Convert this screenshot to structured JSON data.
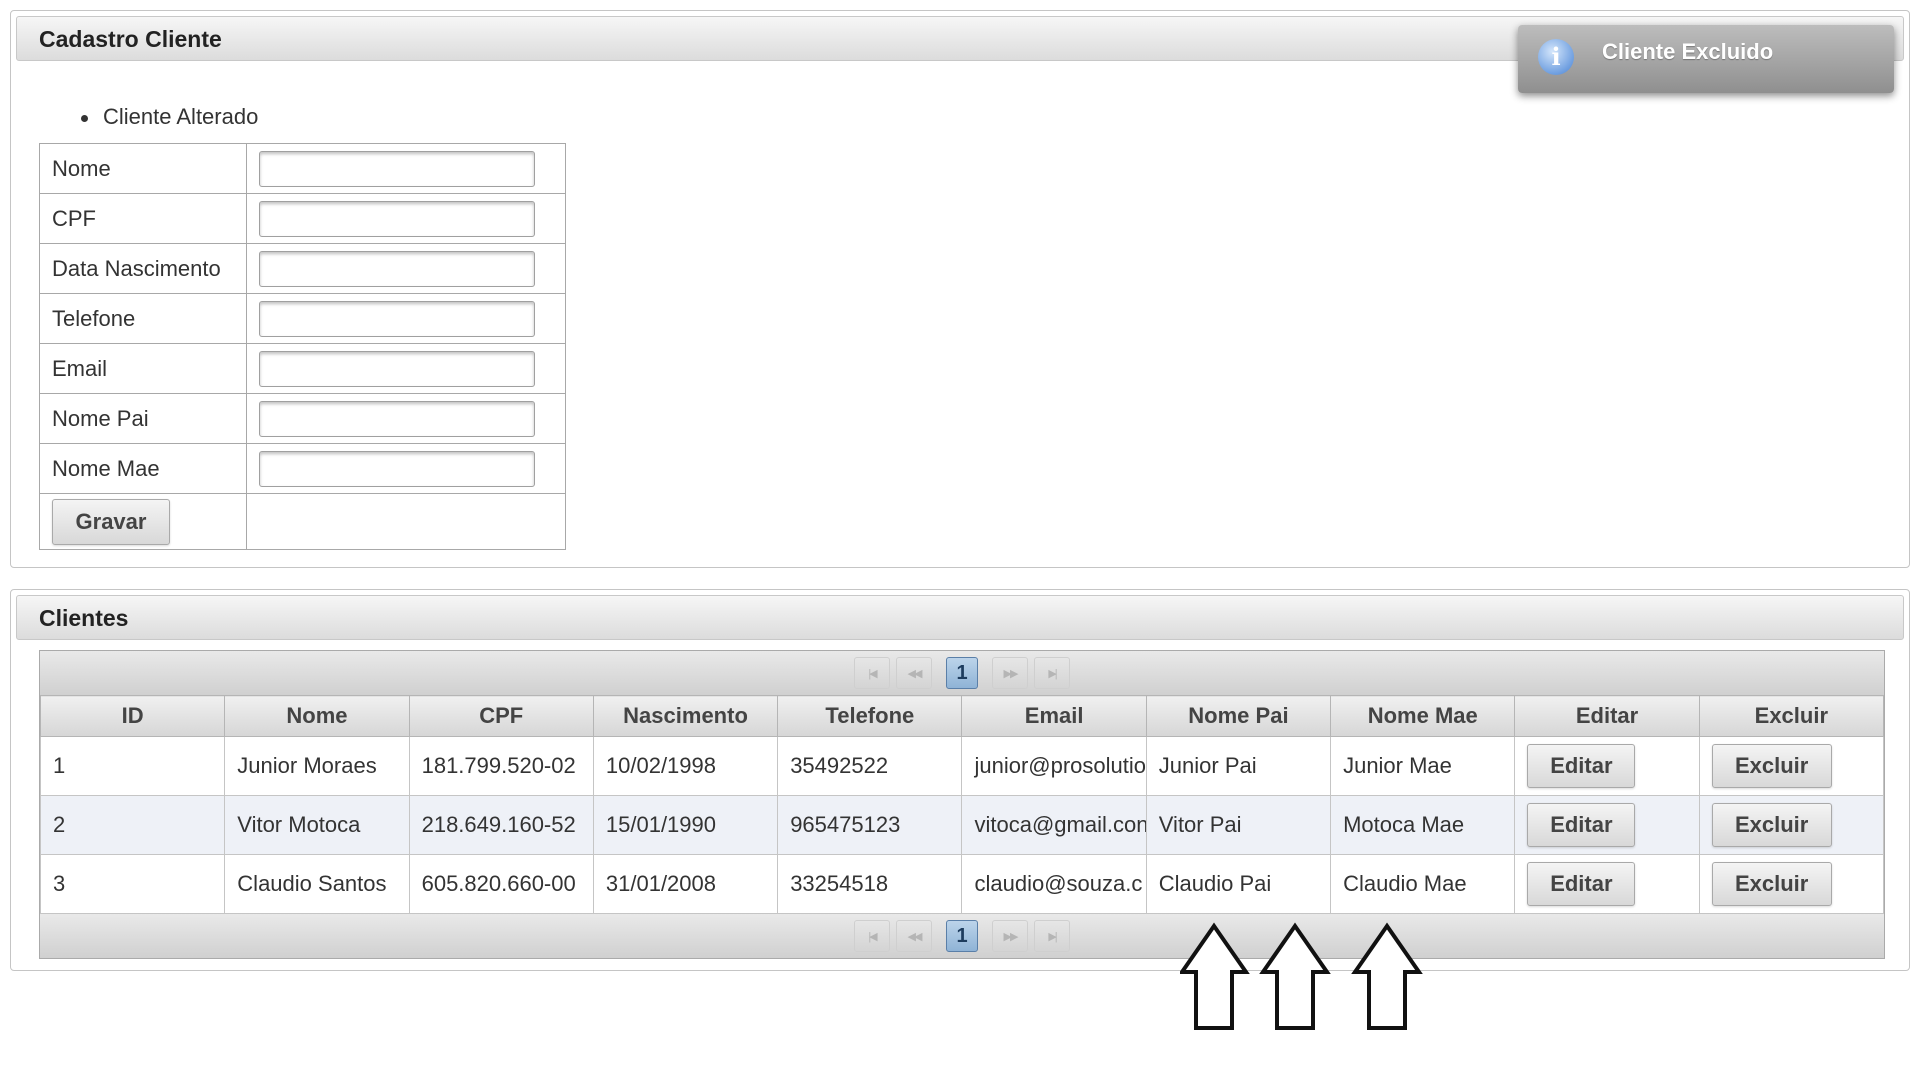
{
  "form_panel": {
    "title": "Cadastro Cliente",
    "message": "Cliente Alterado",
    "fields": [
      {
        "label": "Nome",
        "value": ""
      },
      {
        "label": "CPF",
        "value": ""
      },
      {
        "label": "Data Nascimento",
        "value": ""
      },
      {
        "label": "Telefone",
        "value": ""
      },
      {
        "label": "Email",
        "value": ""
      },
      {
        "label": "Nome Pai",
        "value": ""
      },
      {
        "label": "Nome Mae",
        "value": ""
      }
    ],
    "submit_label": "Gravar"
  },
  "growl": {
    "icon": "info-icon",
    "message": "Cliente Excluido"
  },
  "list_panel": {
    "title": "Clientes",
    "paginator": {
      "current_page": "1",
      "buttons": [
        "first-page-icon",
        "prev-page-icon",
        "next-page-icon",
        "last-page-icon"
      ]
    },
    "columns": [
      "ID",
      "Nome",
      "CPF",
      "Nascimento",
      "Telefone",
      "Email",
      "Nome Pai",
      "Nome Mae",
      "Editar",
      "Excluir"
    ],
    "rows": [
      {
        "id": "1",
        "nome": "Junior Moraes",
        "cpf": "181.799.520-02",
        "nascimento": "10/02/1998",
        "telefone": "35492522",
        "email": "junior@prosolutio",
        "nome_pai": "Junior Pai",
        "nome_mae": "Junior Mae"
      },
      {
        "id": "2",
        "nome": "Vitor Motoca",
        "cpf": "218.649.160-52",
        "nascimento": "15/01/1990",
        "telefone": "965475123",
        "email": "vitoca@gmail.con",
        "nome_pai": "Vitor Pai",
        "nome_mae": "Motoca Mae"
      },
      {
        "id": "3",
        "nome": "Claudio Santos",
        "cpf": "605.820.660-00",
        "nascimento": "31/01/2008",
        "telefone": "33254518",
        "email": "claudio@souza.c",
        "nome_pai": "Claudio Pai",
        "nome_mae": "Claudio Mae"
      }
    ],
    "edit_label": "Editar",
    "delete_label": "Excluir"
  },
  "annotations": {
    "arrows": [
      "up-arrow-icon",
      "up-arrow-icon",
      "up-arrow-icon"
    ]
  },
  "colors": {
    "header_bg": "#dcdcdc",
    "growl_bg": "#9a9a9a",
    "alt_row_bg": "#eef1f7",
    "page_active_bg": "#a6c3e0"
  }
}
